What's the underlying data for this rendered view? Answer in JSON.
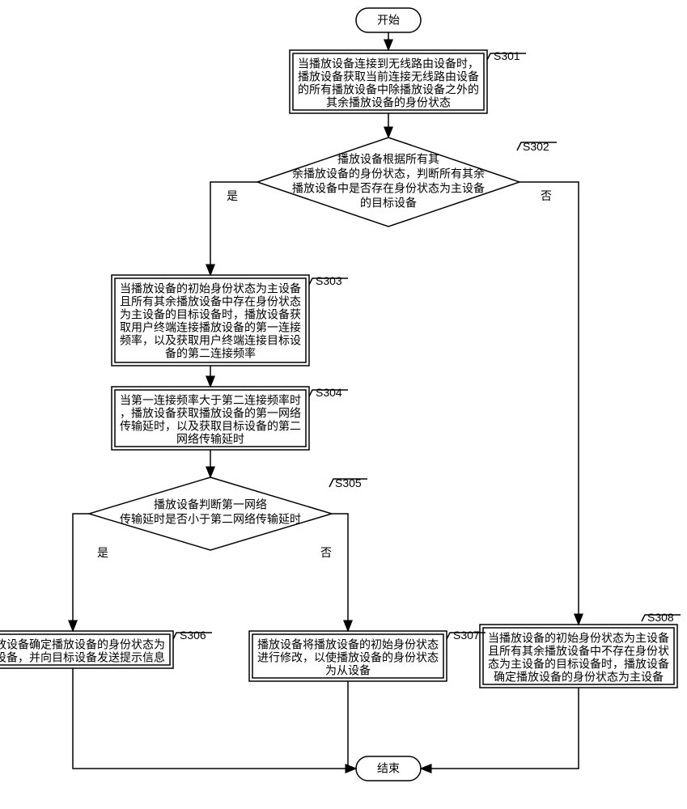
{
  "terminals": {
    "start": "开始",
    "end": "结束"
  },
  "steps": {
    "s301": {
      "label": "S301",
      "lines": [
        "当播放设备连接到无线路由设备时，",
        "播放设备获取当前连接无线路由设备",
        "的所有播放设备中除播放设备之外的",
        "其余播放设备的身份状态"
      ]
    },
    "s302": {
      "label": "S302",
      "lines": [
        "播放设备根据所有其",
        "余播放设备的身份状态，判断所有其余",
        "播放设备中是否存在身份状态为主设备",
        "的目标设备"
      ]
    },
    "s303": {
      "label": "S303",
      "lines": [
        "当播放设备的初始身份状态为主设备",
        "且所有其余播放设备中存在身份状态",
        "为主设备的目标设备时，播放设备获",
        "取用户终端连接播放设备的第一连接",
        "频率，以及获取用户终端连接目标设",
        "备的第二连接频率"
      ]
    },
    "s304": {
      "label": "S304",
      "lines": [
        "当第一连接频率大于第二连接频率时",
        "，播放设备获取播放设备的第一网络",
        "传输延时，以及获取目标设备的第二",
        "网络传输延时"
      ]
    },
    "s305": {
      "label": "S305",
      "lines": [
        "播放设备判断第一网络",
        "传输延时是否小于第二网络传输延时"
      ]
    },
    "s306": {
      "label": "S306",
      "lines": [
        "播放设备确定播放设备的身份状态为",
        "主设备，并向目标设备发送提示信息"
      ]
    },
    "s307": {
      "label": "S307",
      "lines": [
        "播放设备将播放设备的初始身份状态",
        "进行修改，以使播放设备的身份状态",
        "为从设备"
      ]
    },
    "s308": {
      "label": "S308",
      "lines": [
        "当播放设备的初始身份状态为主设备",
        "且所有其余播放设备中不存在身份状",
        "态为主设备的目标设备时，播放设备",
        "确定播放设备的身份状态为主设备"
      ]
    }
  },
  "edges": {
    "yes": "是",
    "no": "否"
  }
}
